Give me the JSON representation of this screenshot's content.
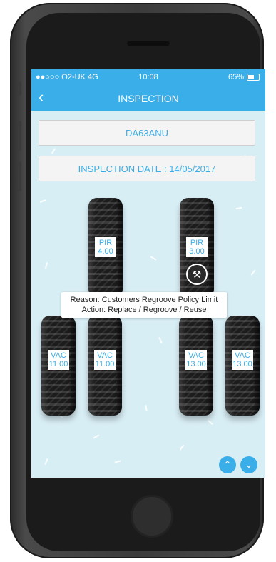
{
  "status": {
    "carrier": "●●○○○ O2-UK  4G",
    "time": "10:08",
    "battery": "65%"
  },
  "nav": {
    "title": "INSPECTION",
    "back_icon": "chevron-left-icon"
  },
  "vehicle": {
    "registration": "DA63ANU",
    "inspection_date": "INSPECTION DATE : 14/05/2017"
  },
  "tyres_top": [
    {
      "code": "PIR",
      "value": "4.00"
    },
    {
      "code": "PIR",
      "value": "3.00"
    }
  ],
  "tyres_bottom": [
    {
      "code": "VAC",
      "value": "11.00"
    },
    {
      "code": "VAC",
      "value": "11.00"
    },
    {
      "code": "VAC",
      "value": "13.00"
    },
    {
      "code": "VAC",
      "value": "13.00"
    }
  ],
  "tooltip": {
    "reason": "Reason: Customers Regroove Policy Limit",
    "action": "Action: Replace / Regroove / Reuse"
  },
  "icons": {
    "wrench": "wrench-icon",
    "up": "chevron-up-icon",
    "down": "chevron-down-icon"
  },
  "colors": {
    "accent": "#3aaee8",
    "screen_bg": "#d8eef5"
  }
}
